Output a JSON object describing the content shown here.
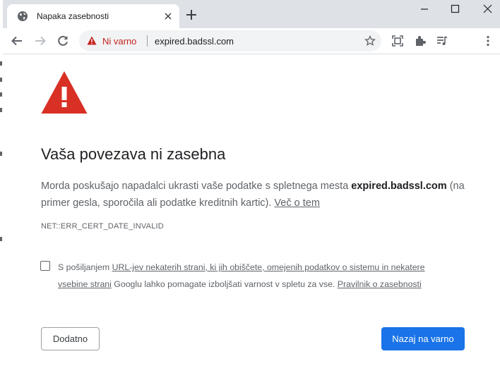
{
  "tab": {
    "title": "Napaka zasebnosti"
  },
  "omnibox": {
    "security_label": "Ni varno",
    "url": "expired.badssl.com"
  },
  "page": {
    "heading": "Vaša povezava ni zasebna",
    "para_lead": "Morda poskušajo napadalci ukrasti vaše podatke s spletnega mesta ",
    "para_domain": "expired.badssl.com",
    "para_tail": " (na primer gesla, sporočila ali podatke kreditnih kartic). ",
    "learn_more": "Več o tem",
    "error_code": "NET::ERR_CERT_DATE_INVALID",
    "optin_lead": "S pošiljanjem ",
    "optin_link": "URL-jev nekaterih strani, ki jih obiščete, omejenih podatkov o sistemu in nekatere vsebine strani",
    "optin_mid": " Googlu lahko pomagate izboljšati varnost v spletu za vse. ",
    "privacy_link": "Pravilnik o zasebnosti",
    "advanced_button": "Dodatno",
    "back_button": "Nazaj na varno"
  },
  "colors": {
    "danger": "#d93025",
    "primary": "#1a73e8",
    "tabbar": "#dee1e6"
  },
  "icons": [
    "globe-icon",
    "close-icon",
    "plus-icon",
    "minimize-icon",
    "maximize-icon",
    "window-close-icon",
    "back-arrow-icon",
    "forward-arrow-icon",
    "reload-icon",
    "warning-icon",
    "star-icon",
    "screenshot-icon",
    "extensions-icon",
    "media-icon",
    "more-vert-icon"
  ]
}
